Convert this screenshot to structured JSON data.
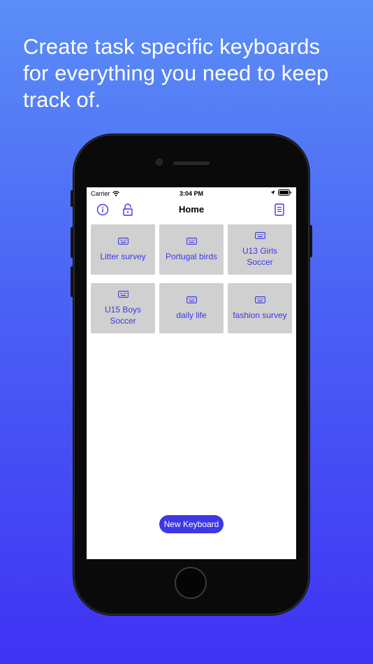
{
  "headline": {
    "line1": "Create task specific keyboards",
    "line2": "for everything you need to keep",
    "line3": "track of."
  },
  "statusbar": {
    "carrier": "Carrier",
    "time": "3:04 PM"
  },
  "navbar": {
    "title": "Home",
    "left_icons": [
      "info-icon",
      "lock-icon"
    ],
    "right_icon": "notebook-icon"
  },
  "keyboards": [
    {
      "label": "Litter survey"
    },
    {
      "label": "Portugal birds"
    },
    {
      "label": "U13 Girls Soccer"
    },
    {
      "label": "U15 Boys Soccer"
    },
    {
      "label": "daily life"
    },
    {
      "label": "fashion survey"
    }
  ],
  "actions": {
    "new_keyboard_label": "New Keyboard"
  },
  "colors": {
    "accent": "#3d37e6",
    "tile_background": "#d0d0d0",
    "gradient_top": "#5b8ef7",
    "gradient_bottom": "#3f33f4"
  }
}
